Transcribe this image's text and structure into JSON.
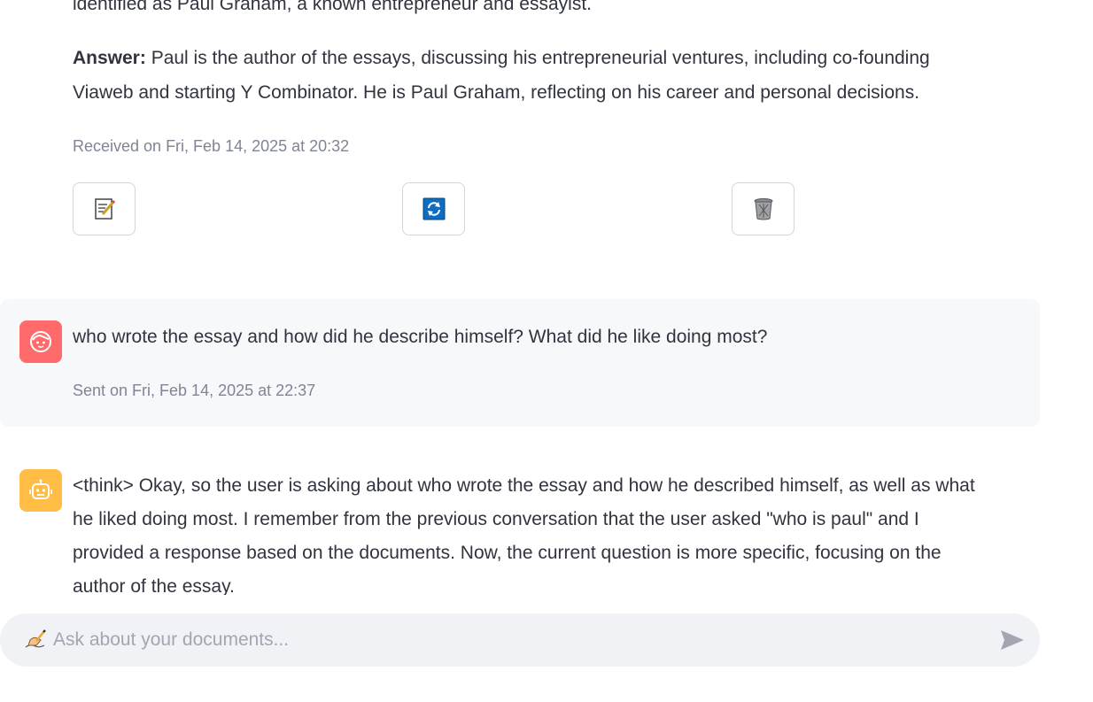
{
  "chat": {
    "previous_answer": {
      "partial_line": "identified as Paul Graham, a known entrepreneur and essayist.",
      "answer_label": "Answer:",
      "answer_line1": " Paul is the author of the essays, discussing his entrepreneurial ventures, including co-founding",
      "answer_line2": "Viaweb and starting Y Combinator. He is Paul Graham, reflecting on his career and personal decisions.",
      "received": "Received on Fri, Feb 14, 2025 at 20:32"
    },
    "actions": {
      "edit_icon": "memo-icon",
      "regenerate_icon": "refresh-icon",
      "delete_icon": "trash-icon"
    },
    "user_message": {
      "text": "who wrote the essay and how did he describe himself? What did he like doing most?",
      "sent": "Sent on Fri, Feb 14, 2025 at 22:37"
    },
    "bot_message": {
      "line1": "<think> Okay, so the user is asking about who wrote the essay and how he described himself, as well as what",
      "line2": "he liked doing most. I remember from the previous conversation that the user asked \"who is paul\" and I",
      "line3": "provided a response based on the documents. Now, the current question is more specific, focusing on the",
      "line4": "author of the essay."
    }
  },
  "input": {
    "placeholder": "Ask about your documents..."
  },
  "colors": {
    "user_avatar": "#ff6b6b",
    "bot_avatar": "#ffbd45",
    "user_bubble": "#f7f8fa",
    "input_bg": "#f0f2f6"
  }
}
